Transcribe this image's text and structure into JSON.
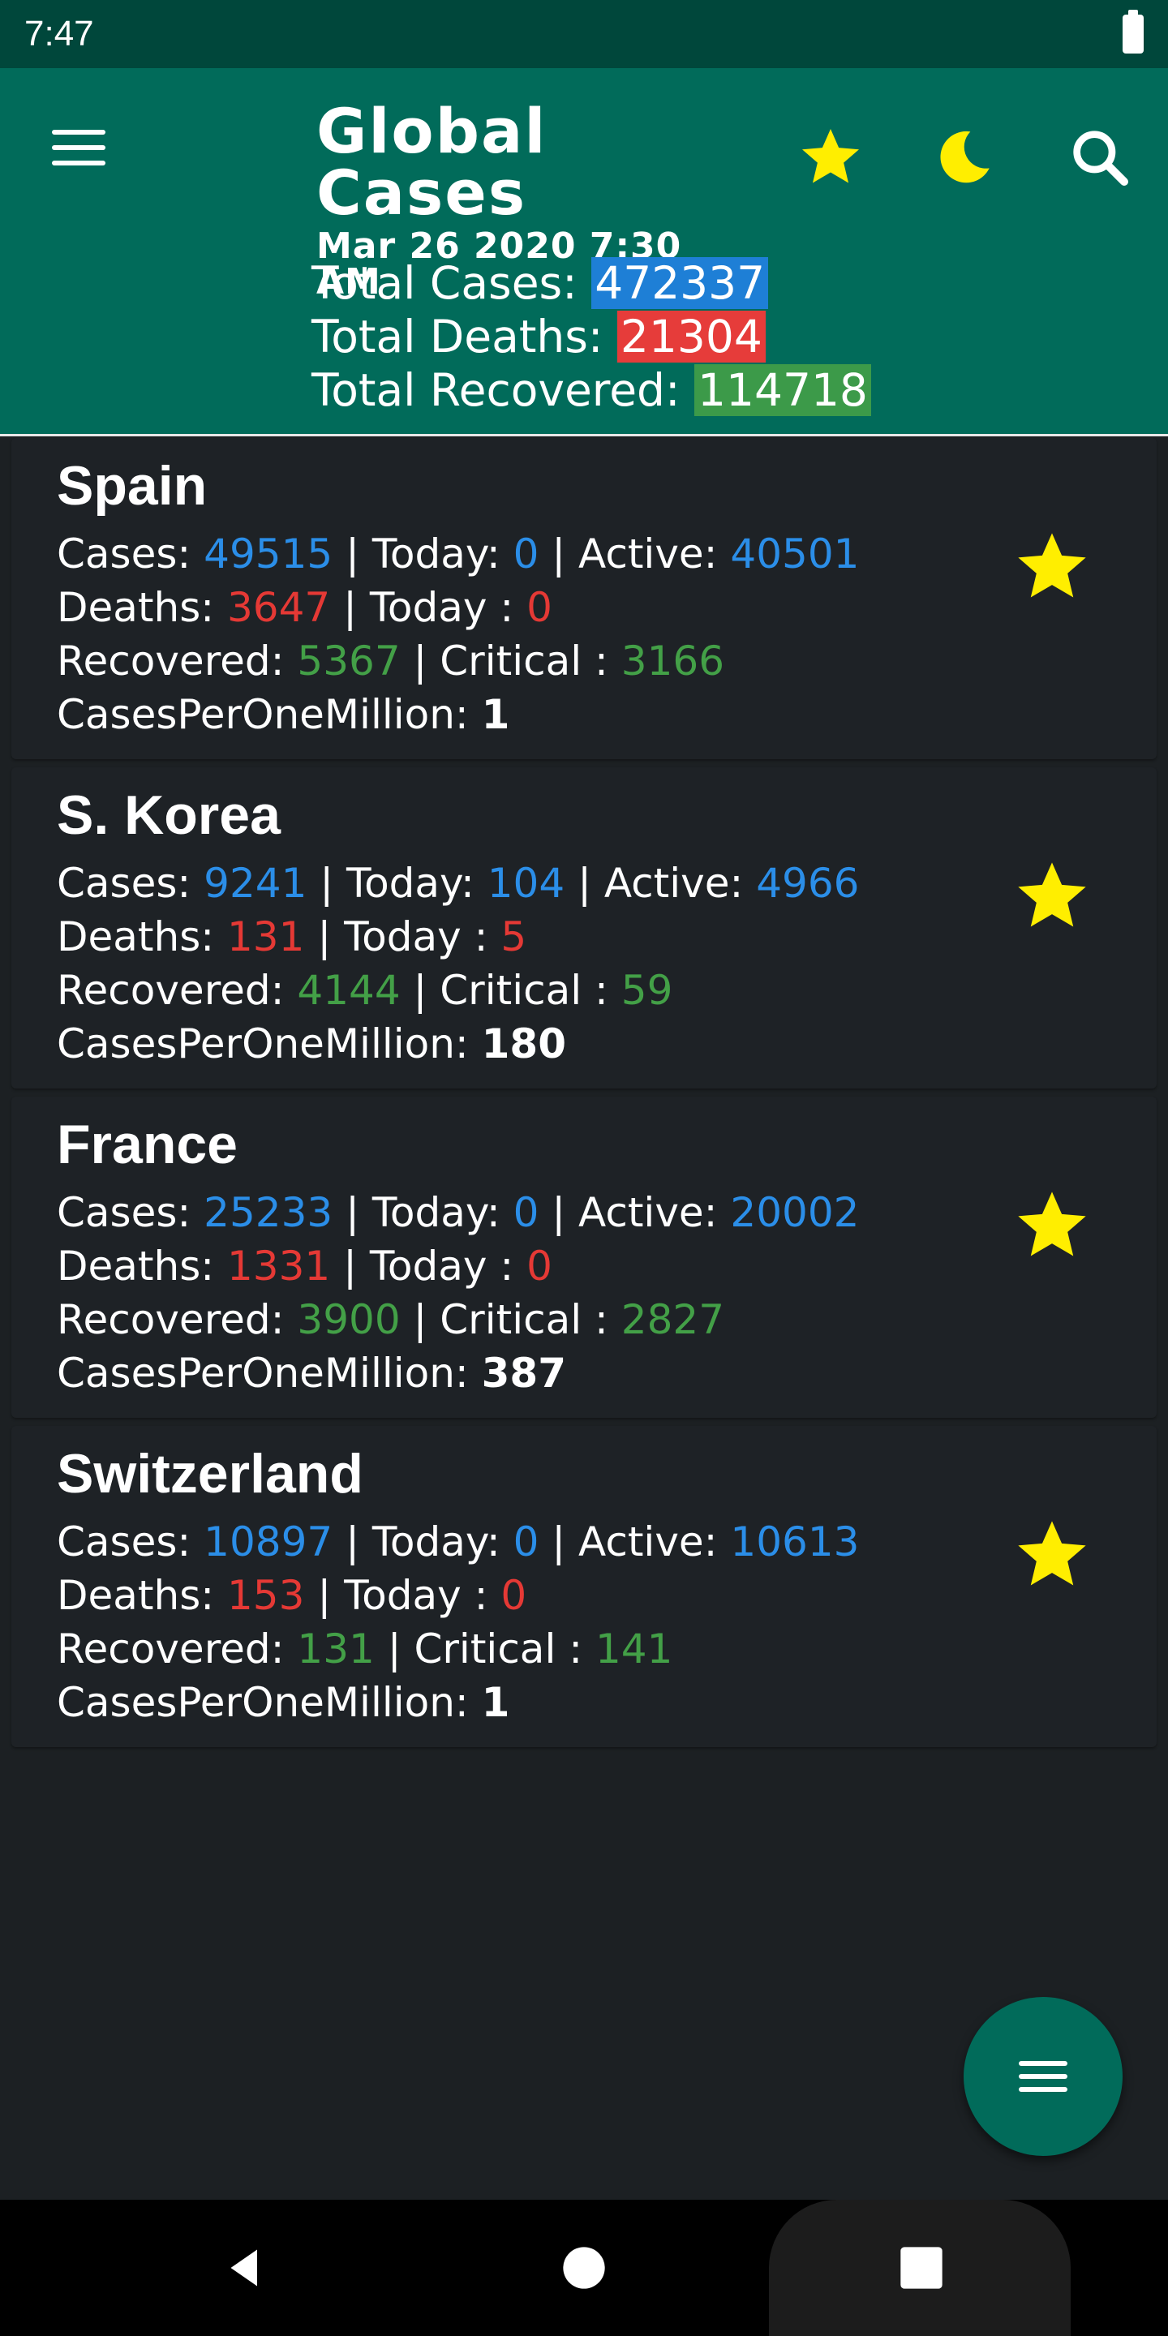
{
  "status_bar": {
    "time": "7:47"
  },
  "app_bar": {
    "title": "Global Cases",
    "date": "Mar 26 2020 7:30 AM",
    "icons": [
      "menu-icon",
      "star-icon",
      "moon-icon",
      "search-icon"
    ],
    "totals": {
      "cases_label": "Total Cases: ",
      "cases_value": "472337",
      "deaths_label": "Total Deaths: ",
      "deaths_value": "21304",
      "recovered_label": "Total Recovered: ",
      "recovered_value": "114718"
    }
  },
  "labels": {
    "cases": "Cases: ",
    "today": " | Today: ",
    "active": " | Active: ",
    "deaths": "Deaths: ",
    "today_deaths": " | Today : ",
    "recovered": "Recovered: ",
    "critical": " | Critical : ",
    "per_million": "CasesPerOneMillion: "
  },
  "countries": [
    {
      "name": "Spain",
      "cases": "49515",
      "today": "0",
      "active": "40501",
      "deaths": "3647",
      "today_deaths": "0",
      "recovered": "5367",
      "critical": "3166",
      "per_million": "1"
    },
    {
      "name": "S. Korea",
      "cases": "9241",
      "today": "104",
      "active": "4966",
      "deaths": "131",
      "today_deaths": "5",
      "recovered": "4144",
      "critical": "59",
      "per_million": "180"
    },
    {
      "name": "France",
      "cases": "25233",
      "today": "0",
      "active": "20002",
      "deaths": "1331",
      "today_deaths": "0",
      "recovered": "3900",
      "critical": "2827",
      "per_million": "387"
    },
    {
      "name": "Switzerland",
      "cases": "10897",
      "today": "0",
      "active": "10613",
      "deaths": "153",
      "today_deaths": "0",
      "recovered": "131",
      "critical": "141",
      "per_million": "1"
    }
  ],
  "colors": {
    "status_bar": "#00473b",
    "app_bar": "#016b5a",
    "background": "#1c2023",
    "cases_blue": "#2b8ee8",
    "deaths_red": "#e53935",
    "recovered_green": "#43a047",
    "star_yellow": "#ffee00"
  }
}
